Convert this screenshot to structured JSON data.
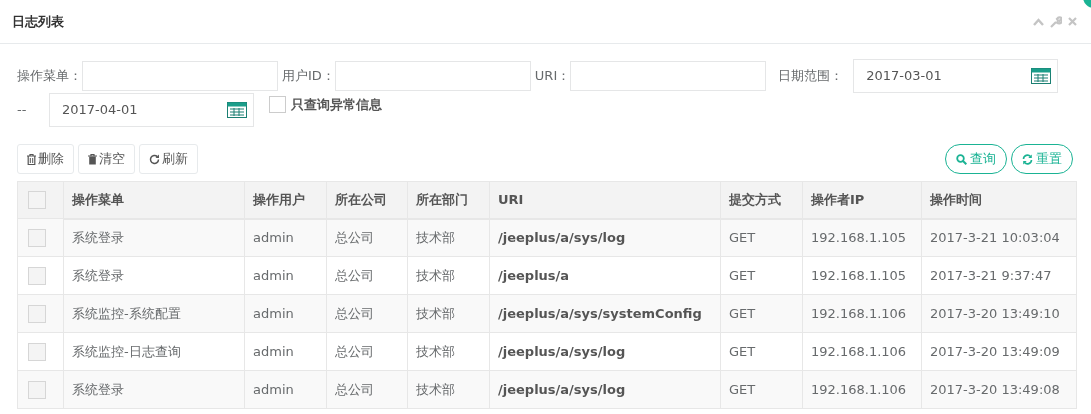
{
  "panel": {
    "title": "日志列表"
  },
  "filters": [
    {
      "label": "操作菜单："
    },
    {
      "label": "用户ID："
    },
    {
      "label": "URI："
    }
  ],
  "date_range": {
    "label": "日期范围：",
    "start": "2017-03-01",
    "separator": "--",
    "end": "2017-04-01"
  },
  "exception_only": {
    "label": "只查询异常信息",
    "checked": false
  },
  "toolbar": [
    {
      "label": "删除",
      "kind": "delete"
    },
    {
      "label": "清空",
      "kind": "clear"
    },
    {
      "label": "刷新",
      "kind": "refresh"
    }
  ],
  "search_buttons": [
    {
      "label": "查询",
      "kind": "search"
    },
    {
      "label": "重置",
      "kind": "reset"
    }
  ],
  "table": {
    "select_all": false,
    "columns": [
      "操作菜单",
      "操作用户",
      "所在公司",
      "所在部门",
      "URI",
      "提交方式",
      "操作者IP",
      "操作时间"
    ],
    "rows": [
      {
        "checked": false,
        "cells": [
          "系统登录",
          "admin",
          "总公司",
          "技术部",
          "/jeeplus/a/sys/log",
          "GET",
          "192.168.1.105",
          "2017-3-21 10:03:04"
        ]
      },
      {
        "checked": false,
        "cells": [
          "系统登录",
          "admin",
          "总公司",
          "技术部",
          "/jeeplus/a",
          "GET",
          "192.168.1.105",
          "2017-3-21 9:37:47"
        ]
      },
      {
        "checked": false,
        "cells": [
          "系统监控-系统配置",
          "admin",
          "总公司",
          "技术部",
          "/jeeplus/a/sys/systemConfig",
          "GET",
          "192.168.1.106",
          "2017-3-20 13:49:10"
        ]
      },
      {
        "checked": false,
        "cells": [
          "系统监控-日志查询",
          "admin",
          "总公司",
          "技术部",
          "/jeeplus/a/sys/log",
          "GET",
          "192.168.1.106",
          "2017-3-20 13:49:09"
        ]
      },
      {
        "checked": false,
        "cells": [
          "系统登录",
          "admin",
          "总公司",
          "技术部",
          "/jeeplus/a/sys/log",
          "GET",
          "192.168.1.106",
          "2017-3-20 13:49:08"
        ]
      }
    ]
  }
}
